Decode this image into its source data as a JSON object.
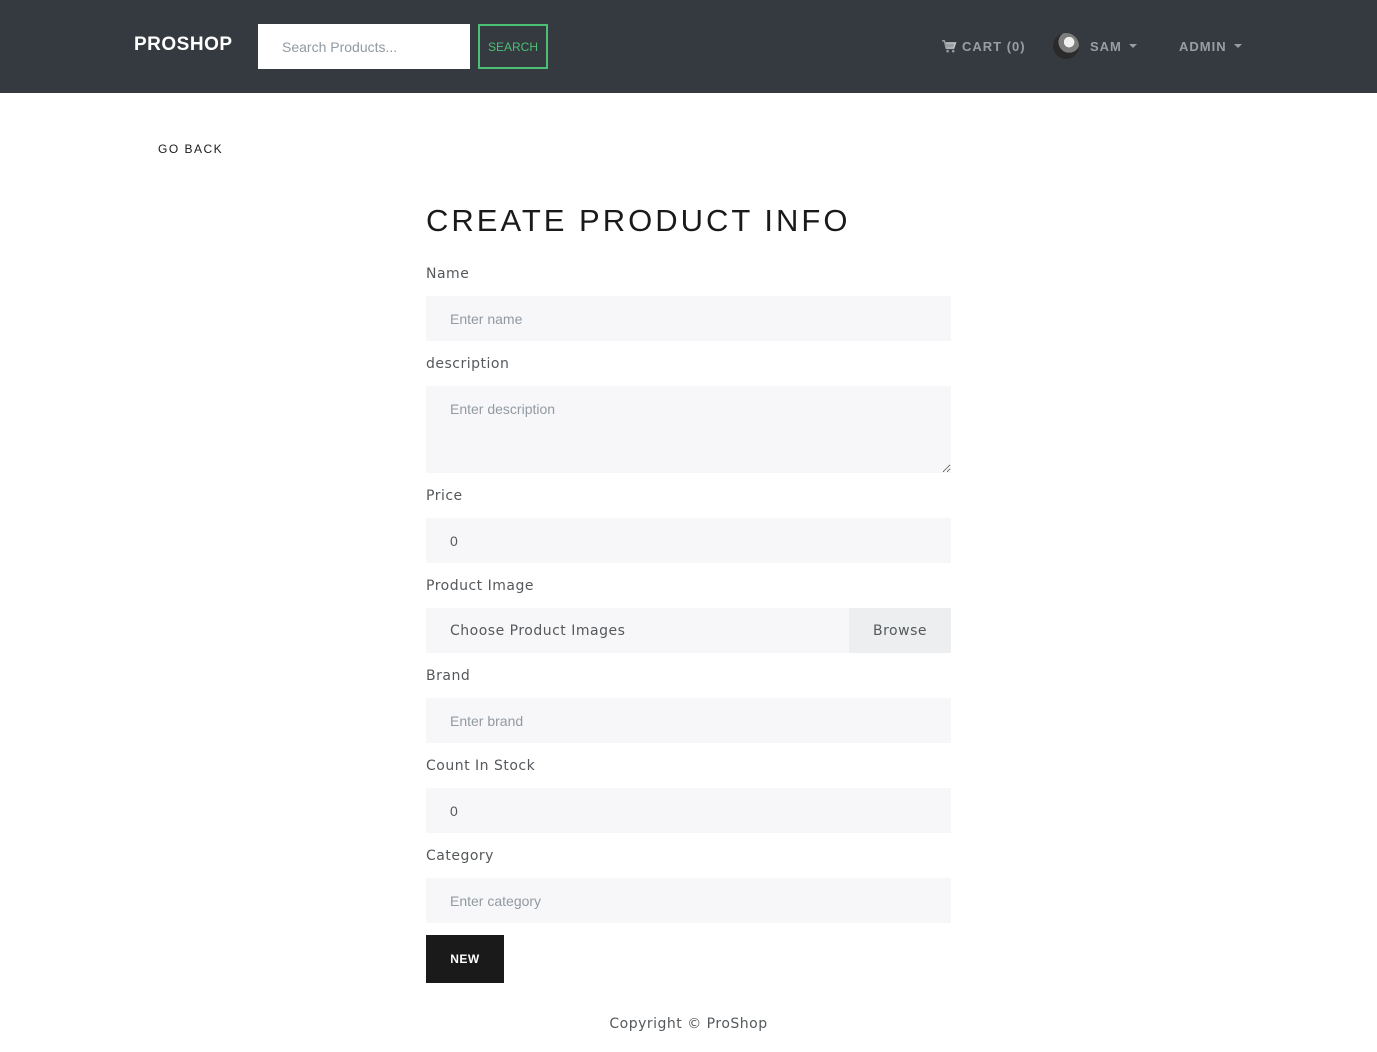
{
  "navbar": {
    "brand": "PROSHOP",
    "search_placeholder": "Search Products...",
    "search_button": "SEARCH",
    "cart_label": "CART (0)",
    "user_name": "SAM",
    "admin_label": "ADMIN"
  },
  "page": {
    "go_back": "GO BACK",
    "title": "CREATE PRODUCT INFO"
  },
  "form": {
    "name": {
      "label": "Name",
      "placeholder": "Enter name"
    },
    "description": {
      "label": "description",
      "placeholder": "Enter description"
    },
    "price": {
      "label": "Price",
      "value": "0"
    },
    "image": {
      "label": "Product Image",
      "file_label": "Choose Product Images",
      "browse": "Browse"
    },
    "brand": {
      "label": "Brand",
      "placeholder": "Enter brand"
    },
    "count": {
      "label": "Count In Stock",
      "value": "0"
    },
    "category": {
      "label": "Category",
      "placeholder": "Enter category"
    },
    "submit": "NEW"
  },
  "footer": {
    "copyright": "Copyright © ProShop"
  },
  "colors": {
    "navbar_bg": "#343a40",
    "accent_green": "#4bbf73",
    "input_bg": "#f7f7f9",
    "button_dark": "#1a1a1a"
  },
  "icons": {
    "cart": "shopping-cart-icon",
    "avatar": "user-avatar",
    "dropdown": "caret-down-icon"
  }
}
